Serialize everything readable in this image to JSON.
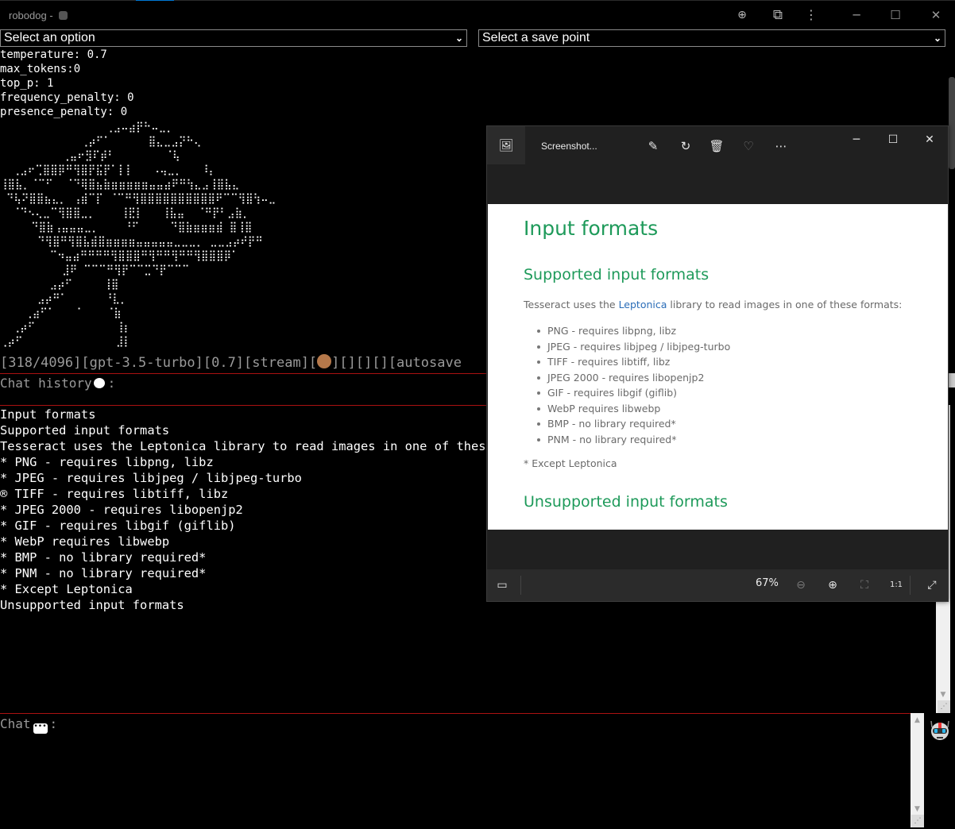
{
  "window": {
    "title": "robodog - ",
    "toolbar_icons": [
      "zoom-in-icon",
      "extensions-icon",
      "more-icon"
    ],
    "controls": {
      "minimize": "─",
      "maximize": "☐",
      "close": "✕"
    }
  },
  "selects": {
    "option": {
      "value": "Select an option"
    },
    "save_point": {
      "value": "Select a save point"
    }
  },
  "settings": [
    "temperature: 0.7",
    "max_tokens:0",
    "top_p: 1",
    "frequency_penalty: 0",
    "presence_penalty: 0"
  ],
  "ascii_art": [
    "                 ⢀⣠⠤⣴⡟⠓⠤⣀⡀",
    "             ⢀⡴⠋⠁      ⣿⣄⣀⣠⡝⠓⢄",
    "          ⢀⣤⠖⣻⠏⡾⠃        ⠈⢧",
    "  ⢀⣠⠖⢉⣿⣿⡿⠛⢻⣿⡟⣯⡟⠁⡇⡇   ⠠⢤⣀⡀   ⠸⡄",
    "⢸⣿⣧⡀⠈⠉⠋  ⠈⠙⢿⣿⣦⣷⣶⣶⣶⣶⣶⣤⣤⣴⠟⠛⢳⣄⣠⢸⣿⣧⣄",
    " ⠙⢧⠝⣿⣿⣦⣄⡀ ⢠⣾⠉⡏ ⠈⠉⠛⢻⣿⣿⣿⣿⣿⣿⣿⣿⣿⣿⠟⠉⠉⢻⣿⢳⠤⣀",
    "  ⠈⠙⠢⢄⣀⠉⢻⣿⣿⣀⡀    ⢸⣟⡇   ⢸⣧⣤  ⠈⠛⡟⠃⣠⣷⡀",
    "     ⠙⣿⣷⢠⣤⣤⣤⣀⡀    ⠘⠋     ⠙⣿⣷⣶⣶⣶⣾ ⣿⢸⣿",
    "      ⠙⢻⣿⠛⢻⣿⣧⣾⣿⣶⣶⣶⣶⣤⣤⣤⣤⣤⣀⣀⣀⡀ ⣀⣀⣠⡴⠞⡟⠛",
    "        ⠉⠲⣤⣴⠛⠛⠛⠛⢻⣿⣿⣿⠛⢻⠛⠛⢻⠛⠛⢻⣿⣿⣿⡿⠁",
    "          ⣸⠟ ⠉⠉⠉⠛⢻⡟⠉⠉⣉⠙⡟⠉⠉⠉",
    "        ⣠⡴⠋     ⢸⣿",
    "      ⣠⡴⠛⠁      ⠘⣇⡀",
    "    ⢀⣴⠋⠁   ⠈    ⠈⣷",
    "  ⢀⡴⠋             ⢸⡆",
    "⢀⡴⠋               ⣸⡇"
  ],
  "status_line": {
    "prefix": "[318/4096][gpt-3.5-turbo][0.7][stream][",
    "suffix": "][][][][autosave"
  },
  "chat_history": {
    "label": "Chat history",
    "suffix": ":"
  },
  "output_lines": [
    "Input formats",
    "Supported input formats",
    "Tesseract uses the Leptonica library to read images in one of these formats:",
    "* PNG - requires libpng, libz",
    "* JPEG - requires libjpeg / libjpeg-turbo",
    "® TIFF - requires libtiff, libz",
    "* JPEG 2000 - requires libopenjp2",
    "* GIF - requires libgif (giflib)",
    "* WebP requires libwebp",
    "* BMP - no library required*",
    "* PNM - no library required*",
    "* Except Leptonica",
    "Unsupported input formats"
  ],
  "chat": {
    "label": "Chat",
    "suffix": ":",
    "value": ""
  },
  "viewer": {
    "title": "Screenshot...",
    "tools": [
      "edit-icon",
      "rotate-icon",
      "delete-icon",
      "favorite-icon",
      "more-icon"
    ],
    "controls": {
      "minimize": "─",
      "maximize": "☐",
      "close": "✕"
    },
    "doc": {
      "h1": "Input formats",
      "h2_supported": "Supported input formats",
      "intro_before": "Tesseract uses the ",
      "intro_link": "Leptonica",
      "intro_after": " library to read images in one of these formats:",
      "items": [
        "PNG - requires libpng, libz",
        "JPEG - requires libjpeg / libjpeg-turbo",
        "TIFF - requires libtiff, libz",
        "JPEG 2000 - requires libopenjp2",
        "GIF - requires libgif (giflib)",
        "WebP requires libwebp",
        "BMP - no library required*",
        "PNM - no library required*"
      ],
      "footnote": "* Except Leptonica",
      "h2_unsupported": "Unsupported input formats"
    },
    "zoom_level": "67%"
  },
  "colors": {
    "background": "#000000",
    "divider": "#aa1111",
    "doc_heading": "#1e9a5a",
    "doc_link": "#2a6db8",
    "accent": "#0078d4"
  }
}
